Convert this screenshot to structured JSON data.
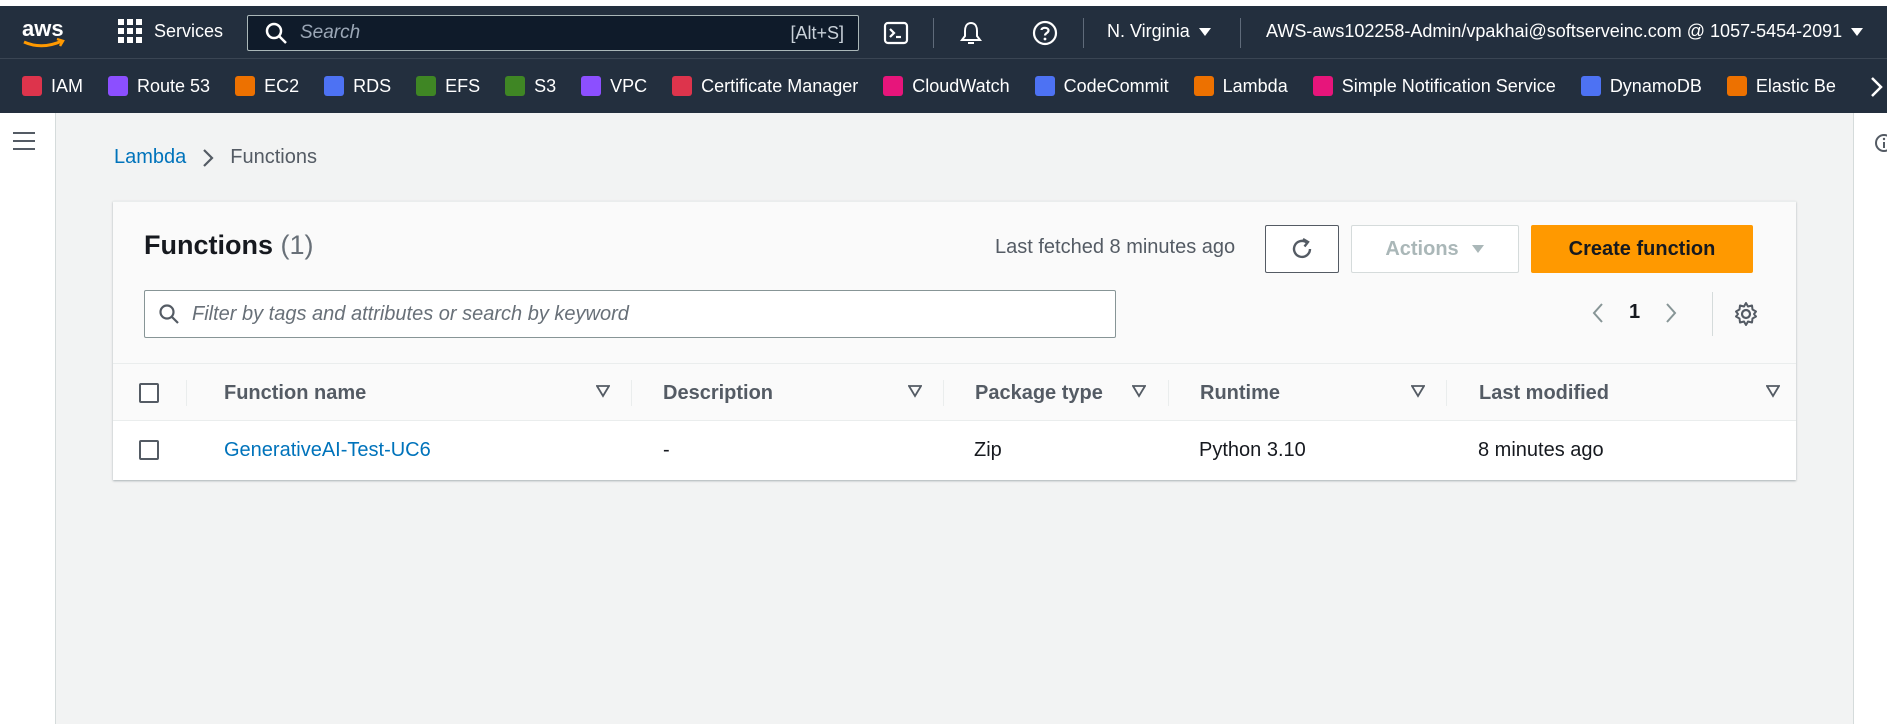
{
  "topbar": {
    "logo_text": "aws",
    "services_label": "Services",
    "search_placeholder": "Search",
    "search_shortcut": "[Alt+S]",
    "region": "N. Virginia",
    "account": "AWS-aws102258-Admin/vpakhai@softserveinc.com @ 1057-5454-2091"
  },
  "favorites": [
    {
      "label": "IAM",
      "color": "#dd344c"
    },
    {
      "label": "Route 53",
      "color": "#8c4fff"
    },
    {
      "label": "EC2",
      "color": "#ed7100"
    },
    {
      "label": "RDS",
      "color": "#4d72f3"
    },
    {
      "label": "EFS",
      "color": "#3f8624"
    },
    {
      "label": "S3",
      "color": "#3f8624"
    },
    {
      "label": "VPC",
      "color": "#8c4fff"
    },
    {
      "label": "Certificate Manager",
      "color": "#dd344c"
    },
    {
      "label": "CloudWatch",
      "color": "#e7157b"
    },
    {
      "label": "CodeCommit",
      "color": "#4d72f3"
    },
    {
      "label": "Lambda",
      "color": "#ed7100"
    },
    {
      "label": "Simple Notification Service",
      "color": "#e7157b"
    },
    {
      "label": "DynamoDB",
      "color": "#4d72f3"
    },
    {
      "label": "Elastic Be",
      "color": "#ed7100"
    }
  ],
  "breadcrumb": {
    "parent": "Lambda",
    "current": "Functions"
  },
  "panel": {
    "title": "Functions",
    "count": "(1)",
    "last_fetched": "Last fetched 8 minutes ago",
    "actions_label": "Actions",
    "create_label": "Create function",
    "filter_placeholder": "Filter by tags and attributes or search by keyword",
    "page": "1"
  },
  "table": {
    "columns": [
      "Function name",
      "Description",
      "Package type",
      "Runtime",
      "Last modified"
    ],
    "rows": [
      {
        "name": "GenerativeAI-Test-UC6",
        "description": "-",
        "package_type": "Zip",
        "runtime": "Python 3.10",
        "last_modified": "8 minutes ago"
      }
    ]
  },
  "colors": {
    "topbar_bg": "#232f3e",
    "link": "#0073bb",
    "primary_button": "#ff9900",
    "page_bg": "#f2f3f3"
  }
}
